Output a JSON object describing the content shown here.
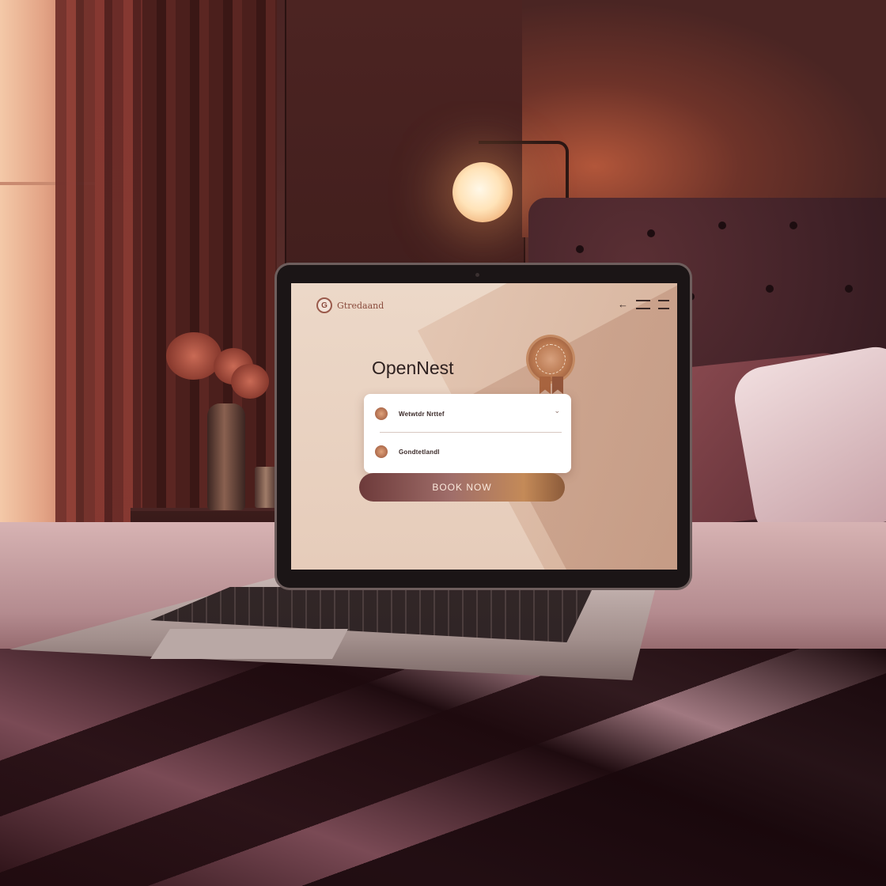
{
  "screen": {
    "logo": {
      "mark": "G",
      "text": "Gtredaand"
    },
    "nav": {
      "back_icon": "back-arrow-icon",
      "menu_icon": "hamburger-menu-icon",
      "back_glyph": "←"
    },
    "brand_title": "OpenNest",
    "badge": {
      "icon": "award-seal-icon"
    },
    "form": {
      "field1": {
        "text": "Wetwtdr Nrttef",
        "icon": "location-pin-icon",
        "chevron": "⌄"
      },
      "field2": {
        "text": "Gondtetlandl",
        "icon": "calendar-pin-icon"
      }
    },
    "book_button": "BOOK NOW"
  },
  "colors": {
    "accent": "#a06e6a",
    "button_gold": "#c48a58",
    "screen_bg": "#ecd8c8",
    "brand_text": "#2e2120"
  }
}
